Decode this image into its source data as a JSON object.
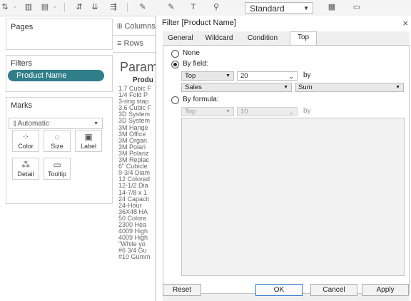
{
  "toolbar": {
    "marks_type_value": "Standard",
    "icons": [
      "swap-icon",
      "bar-chart-icon",
      "sort-ascending-icon",
      "sort-descending-icon",
      "highlight-icon",
      "group-icon",
      "label-icon",
      "fit-icon",
      "pin-icon"
    ]
  },
  "panels": {
    "pages_title": "Pages",
    "filters_title": "Filters",
    "filter_pill": "Product Name",
    "marks_title": "Marks",
    "marks_type": "Automatic",
    "mark_buttons": [
      {
        "label": "Color"
      },
      {
        "label": "Size"
      },
      {
        "label": "Label"
      },
      {
        "label": "Detail"
      },
      {
        "label": "Tooltip"
      }
    ]
  },
  "shelves": {
    "columns": "Columns",
    "rows": "Rows"
  },
  "view": {
    "title": "Param",
    "header": "Produ",
    "items": [
      "1.7 Cubic F",
      "1/4 Fold P",
      "3-ring stap",
      "3.6 Cubic F",
      "3D System",
      "3D System",
      "3M Hange",
      "3M Office",
      "3M Organ",
      "3M Polari",
      "3M Polariz",
      "3M Replac",
      "6\" Cubicle",
      "9-3/4 Diam",
      "12 Colored",
      "12-1/2 Dia",
      "14-7/8 x 1",
      "24 Capacit",
      "24-Hour",
      "36X48 HA",
      "50 Colore",
      "2300 Hea",
      "4009 High",
      "4009 High",
      "\"While yo",
      "#6 3/4 Gu",
      "#10 Gumm"
    ]
  },
  "dialog": {
    "title": "Filter [Product Name]",
    "close": "×",
    "tabs": [
      "General",
      "Wildcard",
      "Condition",
      "Top"
    ],
    "active_tab": "Top",
    "none_label": "None",
    "by_field_label": "By field:",
    "by_field": {
      "direction": "Top",
      "count": "20",
      "by_word": "by",
      "field": "Sales",
      "aggregation": "Sum"
    },
    "by_formula_label": "By formula:",
    "by_formula": {
      "direction": "Top",
      "count": "10",
      "by_word": "by"
    },
    "buttons": {
      "reset": "Reset",
      "ok": "OK",
      "cancel": "Cancel",
      "apply": "Apply"
    }
  }
}
